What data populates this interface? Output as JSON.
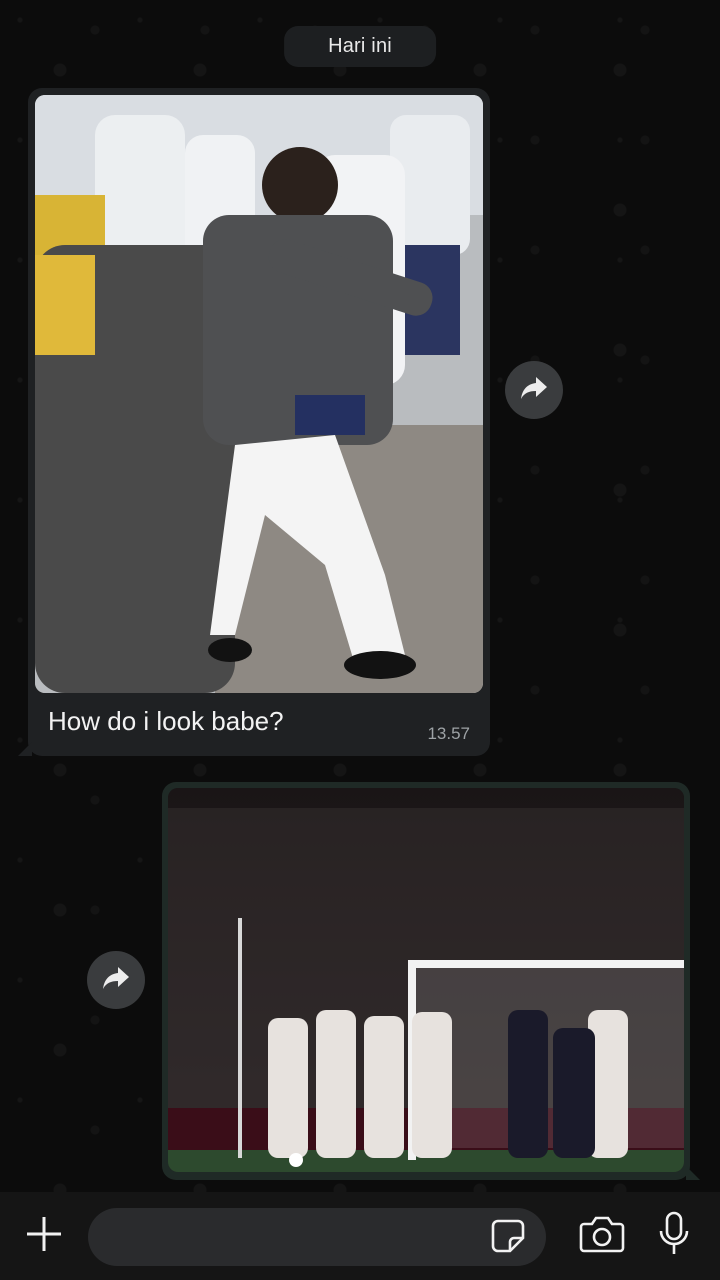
{
  "chat": {
    "date_label": "Hari ini"
  },
  "messages": [
    {
      "direction": "incoming",
      "caption": "How do i look babe?",
      "time": "13.57",
      "media": "photo-boy-in-suit-dancing-at-parade"
    },
    {
      "direction": "outgoing",
      "media": "photo-football-free-kick-wall"
    }
  ],
  "composer": {
    "placeholder": "",
    "icons": {
      "attach": "plus-icon",
      "sticker": "sticker-icon",
      "camera": "camera-icon",
      "mic": "microphone-icon"
    }
  },
  "colors": {
    "background": "#0c0c0c",
    "incoming_bubble": "#1f2123",
    "outgoing_bubble": "#1f2a26",
    "date_pill": "#1d1f21",
    "forward_button": "#3a3c3e"
  }
}
